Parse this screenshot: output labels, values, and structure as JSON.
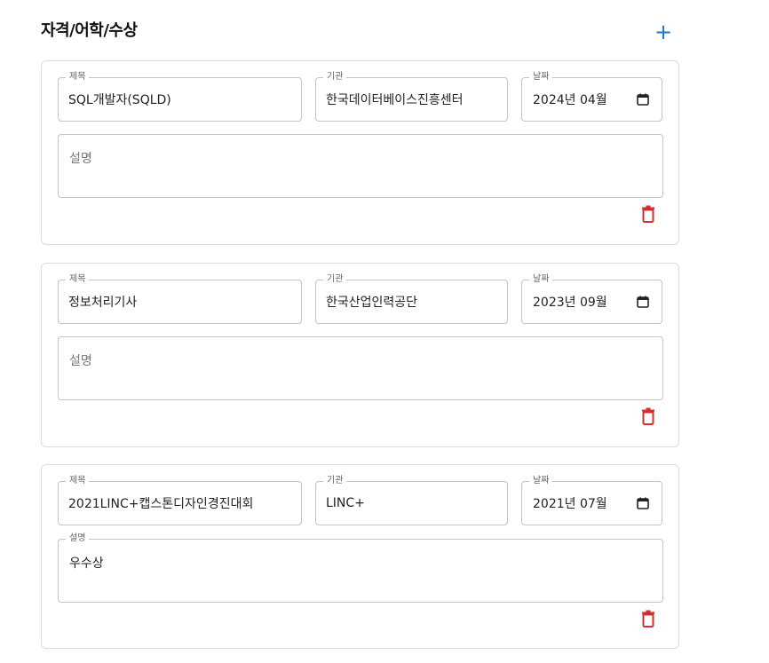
{
  "section": {
    "title": "자격/어학/수상",
    "add_label": "+"
  },
  "labels": {
    "title": "제목",
    "org": "기관",
    "date": "날짜",
    "desc": "설명"
  },
  "entries": [
    {
      "title": "SQL개발자(SQLD)",
      "org": "한국데이터베이스진흥센터",
      "date": "2024년 04월",
      "description": ""
    },
    {
      "title": "정보처리기사",
      "org": "한국산업인력공단",
      "date": "2023년 09월",
      "description": ""
    },
    {
      "title": "2021LINC+캡스톤디자인경진대회",
      "org": "LINC+",
      "date": "2021년 07월",
      "description": "우수상"
    }
  ],
  "colors": {
    "accent": "#1976d2",
    "delete": "#d32f2f",
    "border": "#c4c4c4"
  },
  "icons": {
    "add": "plus-icon",
    "date": "calendar-icon",
    "delete": "trash-icon"
  }
}
